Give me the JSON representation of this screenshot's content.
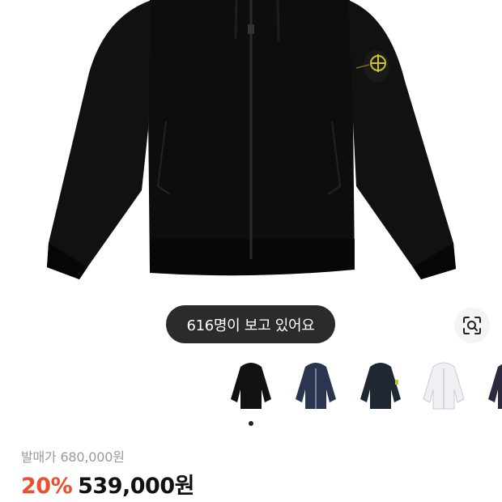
{
  "product": {
    "image_alt": "black zip-up hoodie with sleeve badge",
    "viewers_text": "616명이 보고 있어요",
    "original_price_label": "발매가",
    "original_price": "680,000원",
    "discount": "20%",
    "sale_price": "539,000원"
  },
  "thumbnails": [
    {
      "color": "#111111",
      "name": "black"
    },
    {
      "color": "#2a3650",
      "name": "navy"
    },
    {
      "color": "#1f2733",
      "name": "dark-navy"
    },
    {
      "color": "#eef0f3",
      "name": "white"
    },
    {
      "color": "#2a2a3e",
      "name": "dark-purple"
    }
  ],
  "carousel": {
    "active_index": 0
  },
  "icons": {
    "lens": "image-search-icon"
  },
  "colors": {
    "discount": "#e8502f",
    "pill_bg": "#2b2b2b"
  }
}
